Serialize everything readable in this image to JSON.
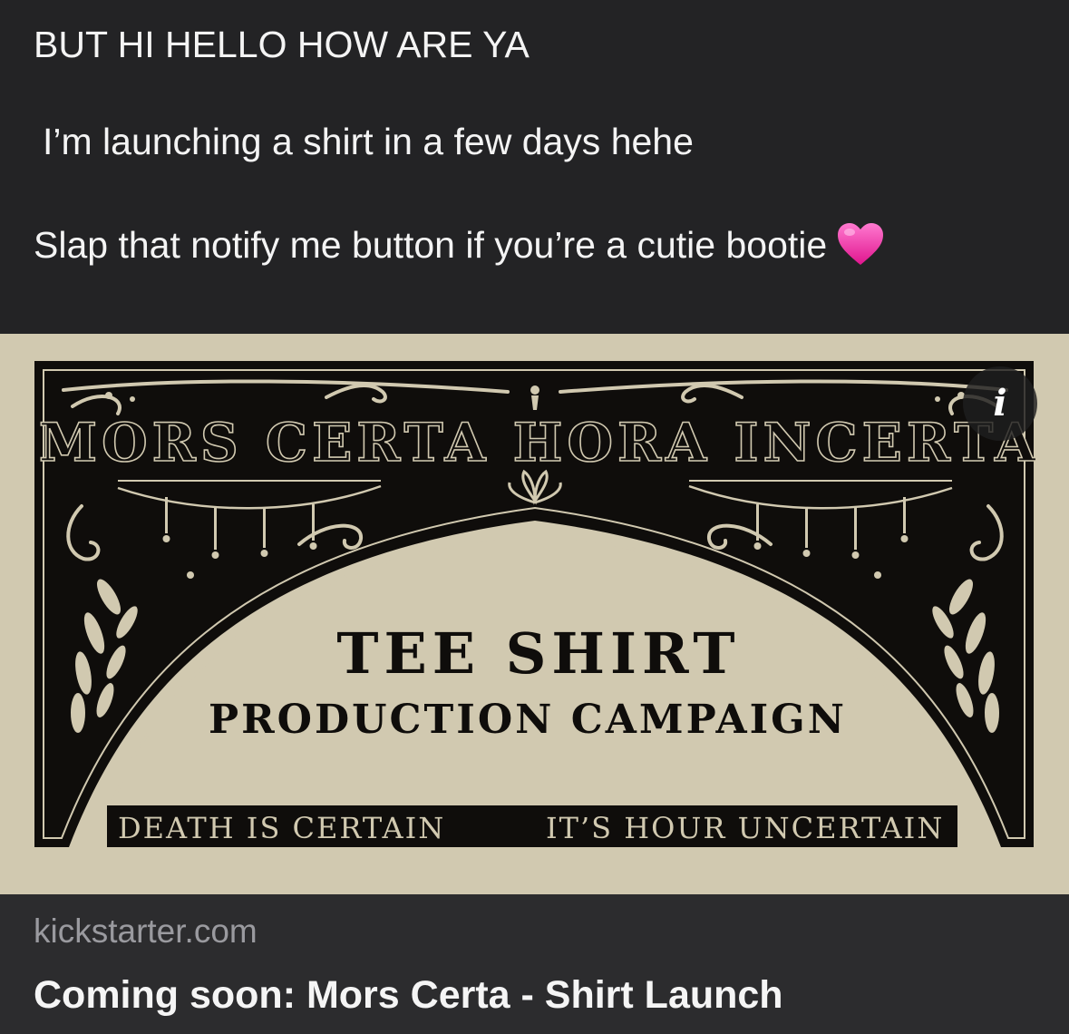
{
  "message": {
    "line1": "BUT HI HELLO HOW ARE YA",
    "line2": "I’m launching a shirt in a few days hehe",
    "line3": "Slap that notify me button if you’re a cutie bootie",
    "emoji": "heart-emoji"
  },
  "banner": {
    "top_text": "MORS CERTA HORA INCERTA",
    "headline": "TEE SHIRT",
    "subheadline": "PRODUCTION CAMPAIGN",
    "footer_left": "DEATH IS CERTAIN",
    "footer_right": "IT’S HOUR UNCERTAIN",
    "colors": {
      "background": "#d1c9b0",
      "ink": "#0f0d0b"
    }
  },
  "info_button": {
    "label": "i"
  },
  "link": {
    "domain": "kickstarter.com",
    "title": "Coming soon: Mors Certa - Shirt Launch"
  }
}
